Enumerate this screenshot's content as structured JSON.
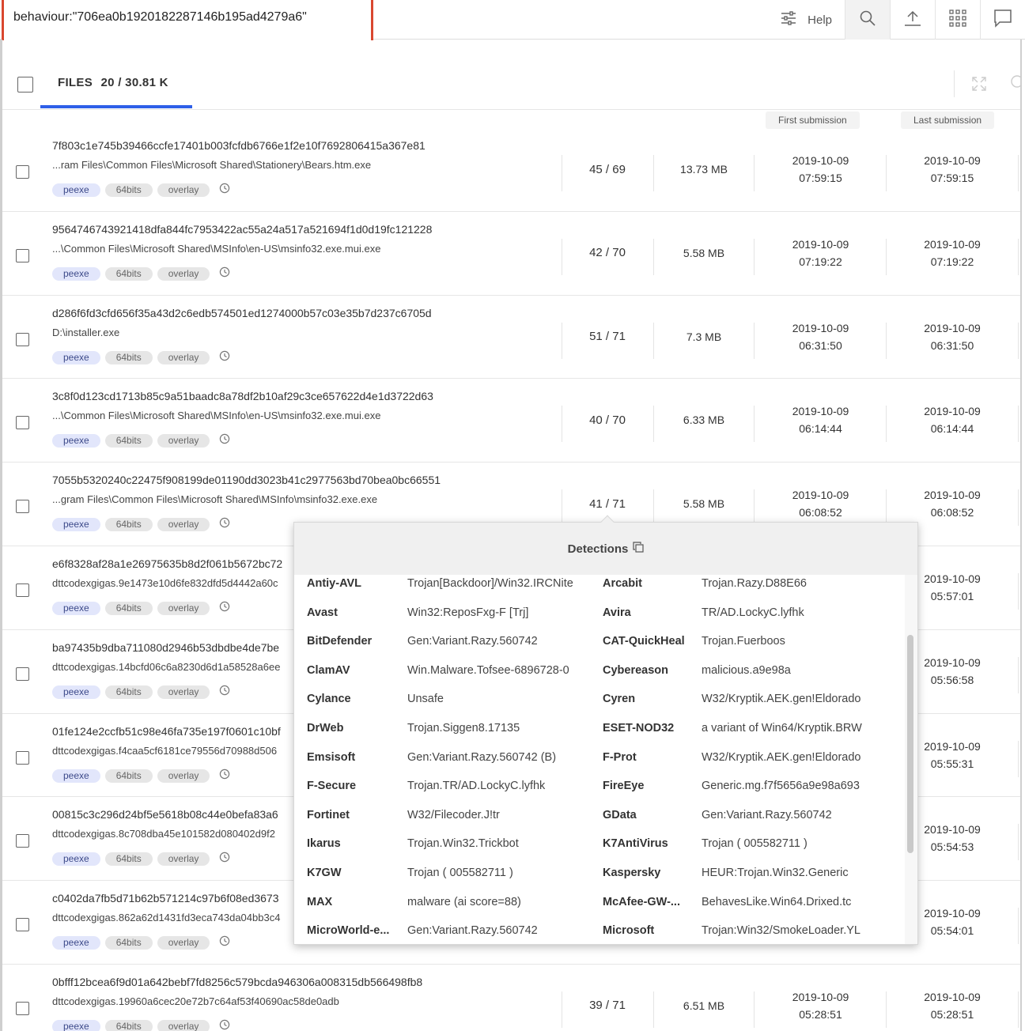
{
  "search": {
    "query": "behaviour:\"706ea0b1920182287146b195ad4279a6\""
  },
  "toolbar": {
    "help_label": "Help"
  },
  "files_tab": {
    "label": "FILES",
    "count": "20 / 30.81 K"
  },
  "columns": {
    "first_submission": "First submission",
    "last_submission": "Last submission"
  },
  "rows": [
    {
      "hash": "7f803c1e745b39466ccfe17401b003fcfdb6766e1f2e10f7692806415a367e81",
      "path": "...ram Files\\Common Files\\Microsoft Shared\\Stationery\\Bears.htm.exe",
      "tags": [
        "peexe",
        "64bits",
        "overlay"
      ],
      "detections": "45 / 69",
      "size": "13.73 MB",
      "first_date": "2019-10-09",
      "first_time": "07:59:15",
      "last_date": "2019-10-09",
      "last_time": "07:59:15"
    },
    {
      "hash": "9564746743921418dfa844fc7953422ac55a24a517a521694f1d0d19fc121228",
      "path": "...\\Common Files\\Microsoft Shared\\MSInfo\\en-US\\msinfo32.exe.mui.exe",
      "tags": [
        "peexe",
        "64bits",
        "overlay"
      ],
      "detections": "42 / 70",
      "size": "5.58 MB",
      "first_date": "2019-10-09",
      "first_time": "07:19:22",
      "last_date": "2019-10-09",
      "last_time": "07:19:22"
    },
    {
      "hash": "d286f6fd3cfd656f35a43d2c6edb574501ed1274000b57c03e35b7d237c6705d",
      "path": "D:\\installer.exe",
      "tags": [
        "peexe",
        "64bits",
        "overlay"
      ],
      "detections": "51 / 71",
      "size": "7.3 MB",
      "first_date": "2019-10-09",
      "first_time": "06:31:50",
      "last_date": "2019-10-09",
      "last_time": "06:31:50"
    },
    {
      "hash": "3c8f0d123cd1713b85c9a51baadc8a78df2b10af29c3ce657622d4e1d3722d63",
      "path": "...\\Common Files\\Microsoft Shared\\MSInfo\\en-US\\msinfo32.exe.mui.exe",
      "tags": [
        "peexe",
        "64bits",
        "overlay"
      ],
      "detections": "40 / 70",
      "size": "6.33 MB",
      "first_date": "2019-10-09",
      "first_time": "06:14:44",
      "last_date": "2019-10-09",
      "last_time": "06:14:44"
    },
    {
      "hash": "7055b5320240c22475f908199de01190dd3023b41c2977563bd70bea0bc66551",
      "path": "...gram Files\\Common Files\\Microsoft Shared\\MSInfo\\msinfo32.exe.exe",
      "tags": [
        "peexe",
        "64bits",
        "overlay"
      ],
      "detections": "41 / 71",
      "size": "5.58 MB",
      "first_date": "2019-10-09",
      "first_time": "06:08:52",
      "last_date": "2019-10-09",
      "last_time": "06:08:52"
    },
    {
      "hash": "e6f8328af28a1e26975635b8d2f061b5672bc72",
      "path": "dttcodexgigas.9e1473e10d6fe832dfd5d4442a60c",
      "tags": [
        "peexe",
        "64bits",
        "overlay"
      ],
      "detections": "",
      "size": "",
      "first_date": "",
      "first_time": "",
      "last_date": "2019-10-09",
      "last_time": "05:57:01"
    },
    {
      "hash": "ba97435b9dba711080d2946b53dbdbe4de7be",
      "path": "dttcodexgigas.14bcfd06c6a8230d6d1a58528a6ee",
      "tags": [
        "peexe",
        "64bits",
        "overlay"
      ],
      "detections": "",
      "size": "",
      "first_date": "",
      "first_time": "",
      "last_date": "2019-10-09",
      "last_time": "05:56:58"
    },
    {
      "hash": "01fe124e2ccfb51c98e46fa735e197f0601c10bf",
      "path": "dttcodexgigas.f4caa5cf6181ce79556d70988d506",
      "tags": [
        "peexe",
        "64bits",
        "overlay"
      ],
      "detections": "",
      "size": "",
      "first_date": "",
      "first_time": "",
      "last_date": "2019-10-09",
      "last_time": "05:55:31"
    },
    {
      "hash": "00815c3c296d24bf5e5618b08c44e0befa83a6",
      "path": "dttcodexgigas.8c708dba45e101582d080402d9f2",
      "tags": [
        "peexe",
        "64bits",
        "overlay"
      ],
      "detections": "",
      "size": "",
      "first_date": "",
      "first_time": "",
      "last_date": "2019-10-09",
      "last_time": "05:54:53"
    },
    {
      "hash": "c0402da7fb5d71b62b571214c97b6f08ed3673",
      "path": "dttcodexgigas.862a62d1431fd3eca743da04bb3c4",
      "tags": [
        "peexe",
        "64bits",
        "overlay"
      ],
      "detections": "",
      "size": "",
      "first_date": "",
      "first_time": "",
      "last_date": "2019-10-09",
      "last_time": "05:54:01"
    },
    {
      "hash": "0bfff12bcea6f9d01a642bebf7fd8256c579bcda946306a008315db566498fb8",
      "path": "dttcodexgigas.19960a6cec20e72b7c64af53f40690ac58de0adb",
      "tags": [
        "peexe",
        "64bits",
        "overlay"
      ],
      "detections": "39 / 71",
      "size": "6.51 MB",
      "first_date": "2019-10-09",
      "first_time": "05:28:51",
      "last_date": "2019-10-09",
      "last_time": "05:28:51"
    }
  ],
  "detections_popup": {
    "title": "Detections",
    "rows": [
      [
        "Antiy-AVL",
        "Trojan[Backdoor]/Win32.IRCNite",
        "Arcabit",
        "Trojan.Razy.D88E66"
      ],
      [
        "Avast",
        "Win32:ReposFxg-F [Trj]",
        "Avira",
        "TR/AD.LockyC.lyfhk"
      ],
      [
        "BitDefender",
        "Gen:Variant.Razy.560742",
        "CAT-QuickHeal",
        "Trojan.Fuerboos"
      ],
      [
        "ClamAV",
        "Win.Malware.Tofsee-6896728-0",
        "Cybereason",
        "malicious.a9e98a"
      ],
      [
        "Cylance",
        "Unsafe",
        "Cyren",
        "W32/Kryptik.AEK.gen!Eldorado"
      ],
      [
        "DrWeb",
        "Trojan.Siggen8.17135",
        "ESET-NOD32",
        "a variant of Win64/Kryptik.BRW"
      ],
      [
        "Emsisoft",
        "Gen:Variant.Razy.560742 (B)",
        "F-Prot",
        "W32/Kryptik.AEK.gen!Eldorado"
      ],
      [
        "F-Secure",
        "Trojan.TR/AD.LockyC.lyfhk",
        "FireEye",
        "Generic.mg.f7f5656a9e98a693"
      ],
      [
        "Fortinet",
        "W32/Filecoder.J!tr",
        "GData",
        "Gen:Variant.Razy.560742"
      ],
      [
        "Ikarus",
        "Trojan.Win32.Trickbot",
        "K7AntiVirus",
        "Trojan ( 005582711 )"
      ],
      [
        "K7GW",
        "Trojan ( 005582711 )",
        "Kaspersky",
        "HEUR:Trojan.Win32.Generic"
      ],
      [
        "MAX",
        "malware (ai score=88)",
        "McAfee-GW-...",
        "BehavesLike.Win64.Drixed.tc"
      ],
      [
        "MicroWorld-e...",
        "Gen:Variant.Razy.560742",
        "Microsoft",
        "Trojan:Win32/SmokeLoader.YL"
      ]
    ]
  }
}
